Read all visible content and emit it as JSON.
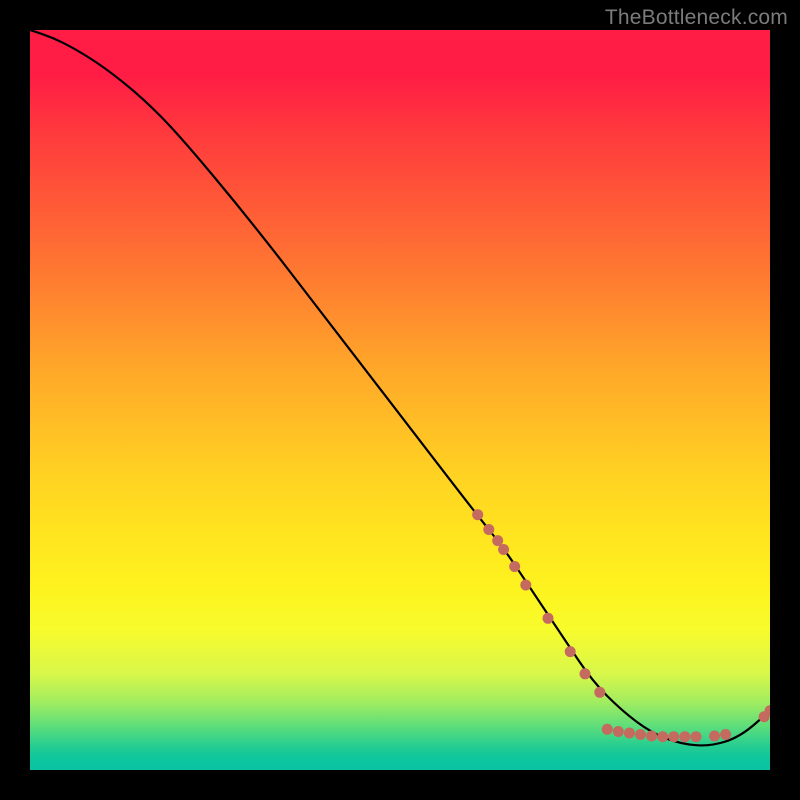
{
  "watermark": {
    "text": "TheBottleneck.com"
  },
  "colors": {
    "background": "#000000",
    "curve": "#000000",
    "marker": "#c46a5e",
    "gradient_top": "#ff1c45",
    "gradient_bottom": "#09c3a3"
  },
  "chart_data": {
    "type": "line",
    "title": "",
    "xlabel": "",
    "ylabel": "",
    "xlim": [
      0,
      100
    ],
    "ylim": [
      0,
      100
    ],
    "grid": false,
    "legend": false,
    "x": [
      0,
      3,
      6,
      10,
      15,
      20,
      30,
      40,
      50,
      60,
      64,
      68,
      72,
      76,
      80,
      84,
      88,
      92,
      96,
      100
    ],
    "y": [
      100,
      99,
      97.5,
      95,
      91,
      86,
      74,
      61,
      48,
      35,
      30,
      24,
      18,
      12,
      8,
      5,
      3.5,
      3.2,
      4.5,
      8
    ],
    "markers": [
      {
        "x": 60.5,
        "y": 34.5
      },
      {
        "x": 62.0,
        "y": 32.5
      },
      {
        "x": 63.2,
        "y": 31.0
      },
      {
        "x": 64.0,
        "y": 29.8
      },
      {
        "x": 65.5,
        "y": 27.5
      },
      {
        "x": 67.0,
        "y": 25.0
      },
      {
        "x": 70.0,
        "y": 20.5
      },
      {
        "x": 73.0,
        "y": 16.0
      },
      {
        "x": 75.0,
        "y": 13.0
      },
      {
        "x": 77.0,
        "y": 10.5
      },
      {
        "x": 78.0,
        "y": 5.5
      },
      {
        "x": 79.5,
        "y": 5.2
      },
      {
        "x": 81.0,
        "y": 5.0
      },
      {
        "x": 82.5,
        "y": 4.8
      },
      {
        "x": 84.0,
        "y": 4.6
      },
      {
        "x": 85.5,
        "y": 4.5
      },
      {
        "x": 87.0,
        "y": 4.5
      },
      {
        "x": 88.5,
        "y": 4.5
      },
      {
        "x": 90.0,
        "y": 4.5
      },
      {
        "x": 92.5,
        "y": 4.6
      },
      {
        "x": 94.0,
        "y": 4.8
      },
      {
        "x": 99.2,
        "y": 7.2
      },
      {
        "x": 100.0,
        "y": 8.0
      }
    ]
  }
}
